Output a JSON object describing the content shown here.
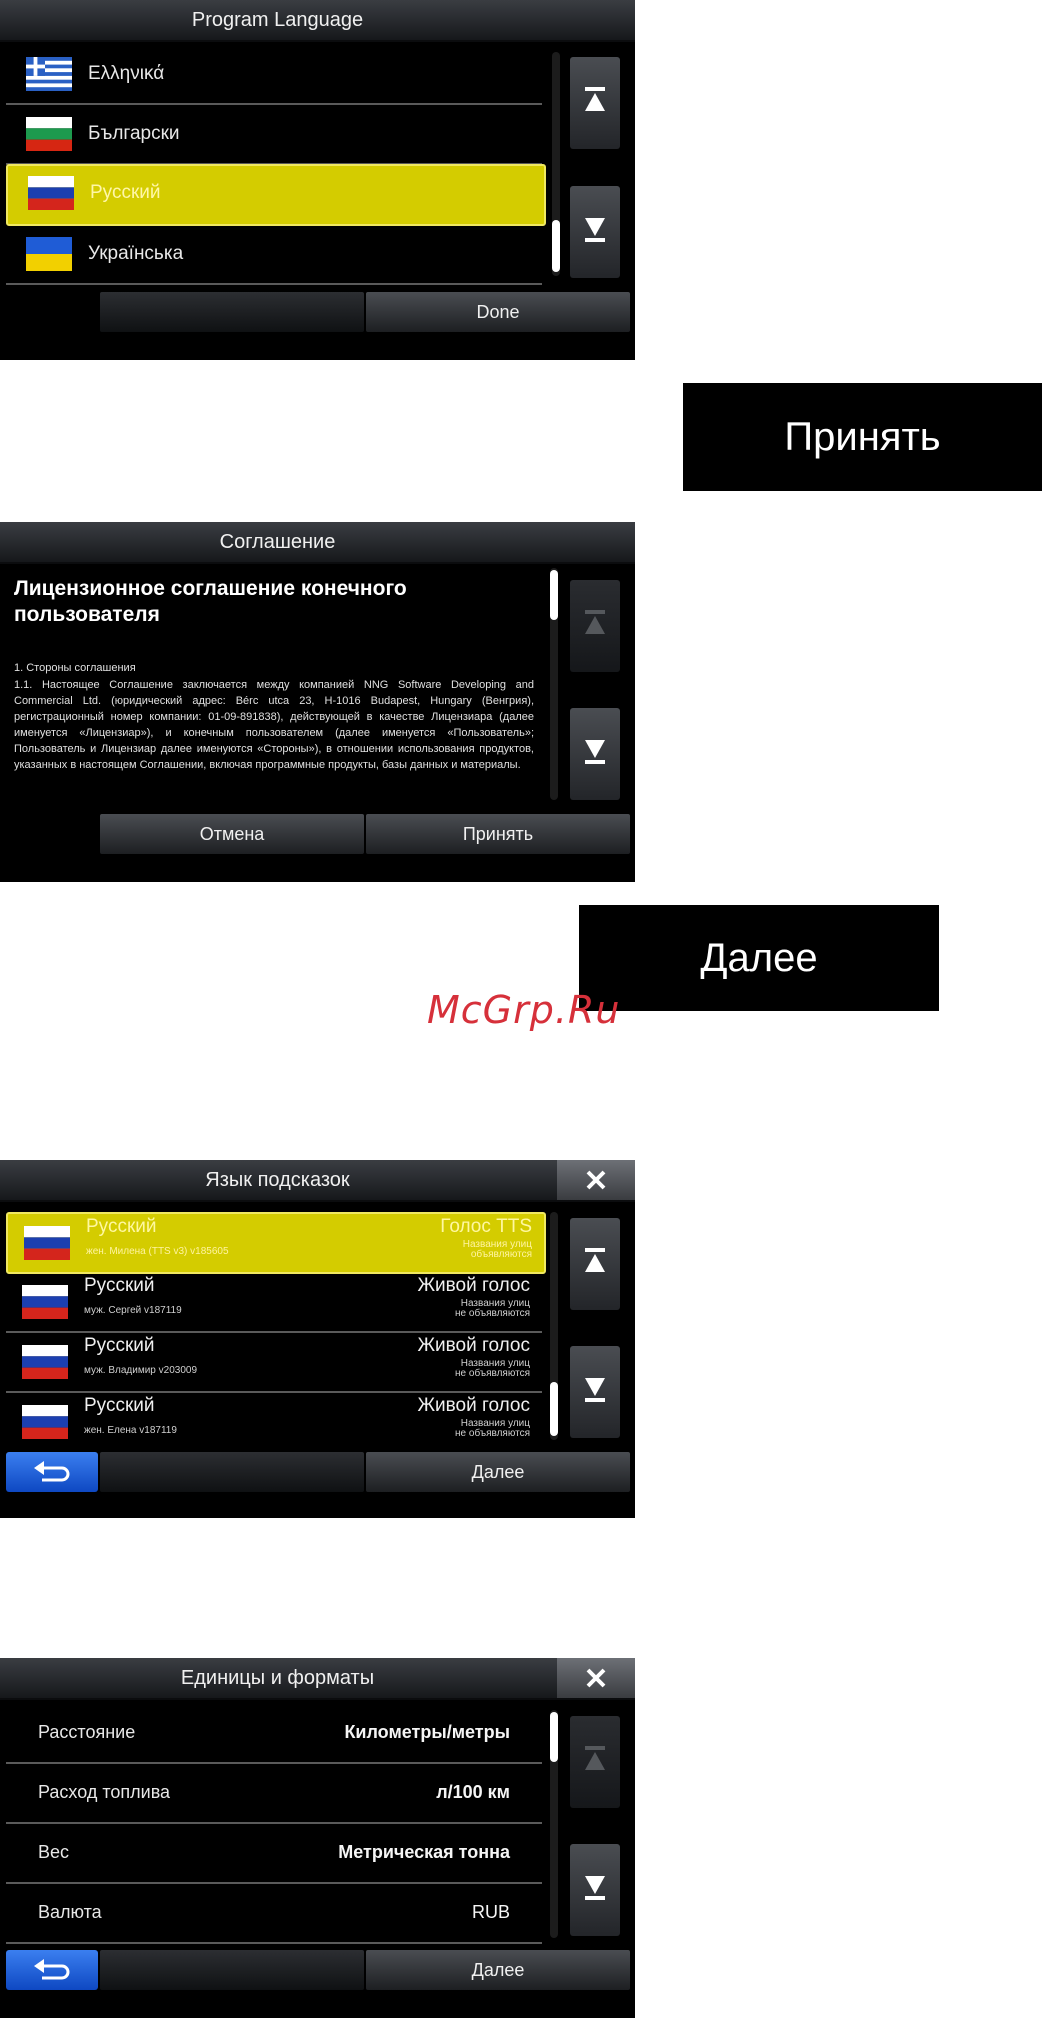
{
  "screen1": {
    "title": "Program Language",
    "languages": [
      {
        "label": "Ελληνικά",
        "flag": "greece-flag"
      },
      {
        "label": "Български",
        "flag": "bulgaria-flag"
      },
      {
        "label": "Русский",
        "flag": "russia-flag",
        "selected": true
      },
      {
        "label": "Українська",
        "flag": "ukraine-flag"
      }
    ],
    "done_label": "Done"
  },
  "callout_accept": "Принять",
  "screen2": {
    "title": "Соглашение",
    "heading": "Лицензионное соглашение конечного пользователя",
    "section": "1. Стороны соглашения",
    "body": "1.1. Настоящее Соглашение заключается между компанией NNG Software Developing and Commercial Ltd. (юридический адрес: Bérc utca 23, H-1016 Budapest, Hungary (Венгрия), регистрационный номер компании: 01-09-891838), действующей в качестве Лицензиара (далее именуется «Лицензиар»), и конечным пользователем (далее именуется «Пользователь»; Пользователь и Лицензиар далее именуются «Стороны»), в отношении использования продуктов, указанных в настоящем Соглашении, включая программные продукты, базы данных и материалы.",
    "cancel_label": "Отмена",
    "accept_label": "Принять"
  },
  "callout_next": "Далее",
  "watermark": "McGrp.Ru",
  "screen3": {
    "title": "Язык подсказок",
    "voices": [
      {
        "name": "Русский",
        "sub": "жен. Милена (TTS v3) v185605",
        "type": "Голос TTS",
        "note1": "Названия улиц",
        "note2": "объявляются",
        "selected": true
      },
      {
        "name": "Русский",
        "sub": "муж. Сергей v187119",
        "type": "Живой голос",
        "note1": "Названия улиц",
        "note2": "не объявляются"
      },
      {
        "name": "Русский",
        "sub": "муж. Владимир v203009",
        "type": "Живой голос",
        "note1": "Названия улиц",
        "note2": "не объявляются"
      },
      {
        "name": "Русский",
        "sub": "жен. Елена v187119",
        "type": "Живой голос",
        "note1": "Названия улиц",
        "note2": "не объявляются"
      }
    ],
    "next_label": "Далее"
  },
  "screen4": {
    "title": "Единицы и форматы",
    "rows": [
      {
        "label": "Расстояние",
        "value": "Километры/метры"
      },
      {
        "label": "Расход топлива",
        "value": "л/100 км"
      },
      {
        "label": "Вес",
        "value": "Метрическая тонна"
      },
      {
        "label": "Валюта",
        "value": "RUB"
      }
    ],
    "next_label": "Далее"
  },
  "colors": {
    "highlight": "#d4cc00",
    "back_button": "#1f5ee0",
    "watermark": "#d6303a"
  }
}
